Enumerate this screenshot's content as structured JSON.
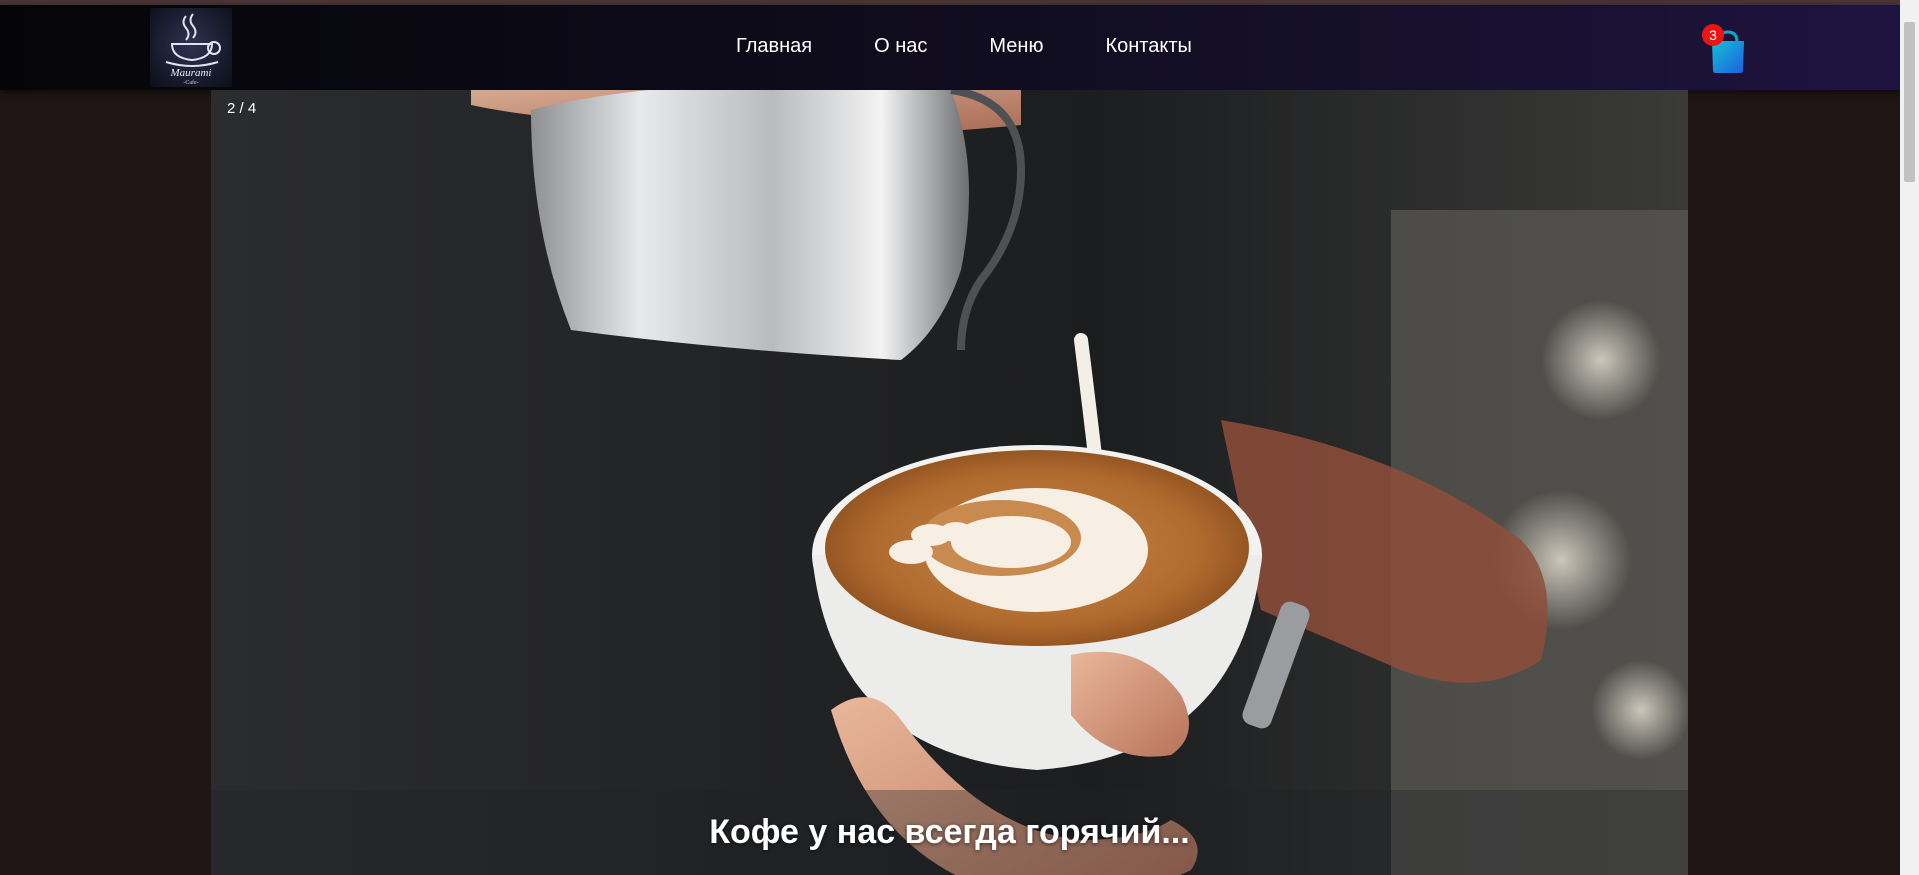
{
  "brand": {
    "logo_text": "Maurami",
    "logo_subtext": "Cafe"
  },
  "nav": {
    "items": [
      {
        "label": "Главная"
      },
      {
        "label": "О нас"
      },
      {
        "label": "Меню"
      },
      {
        "label": "Контакты"
      }
    ]
  },
  "cart": {
    "count": "3",
    "icon": "shopping-bag-icon"
  },
  "slideshow": {
    "counter": "2 / 4",
    "caption": "Кофе у нас всегда горячий...",
    "image": "latte-art-pour"
  },
  "colors": {
    "page_bg": "#1e1514",
    "nav_gradient_end": "#1e1340",
    "badge": "#ee1414",
    "cart_bag": "#1e88e5"
  }
}
